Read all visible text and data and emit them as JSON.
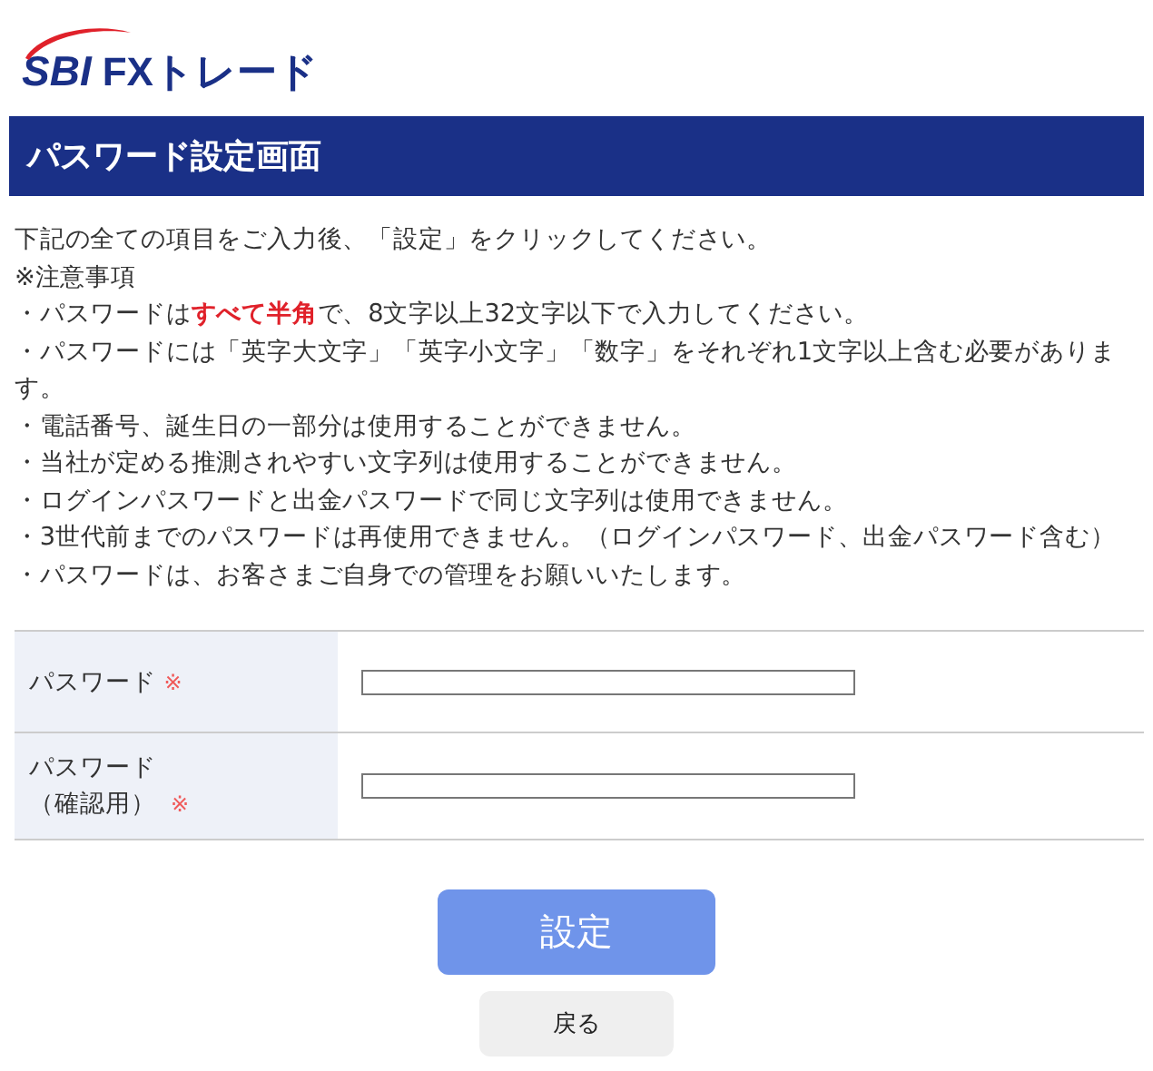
{
  "logo": {
    "brand": "SBI",
    "product": "FXトレード"
  },
  "title": "パスワード設定画面",
  "intro": "下記の全ての項目をご入力後、「設定」をクリックしてください。",
  "notes_heading": "※注意事項",
  "notes": [
    "・パスワードは**すべて半角**で、8文字以上32文字以下で入力してください。",
    "・パスワードには「英字大文字」「英字小文字」「数字」をそれぞれ1文字以上含む必要があります。",
    "・電話番号、誕生日の一部分は使用することができません。",
    "・当社が定める推測されやすい文字列は使用することができません。",
    "・ログインパスワードと出金パスワードで同じ文字列は使用できません。",
    "・3世代前までのパスワードは再使用できません。（ログインパスワード、出金パスワード含む）",
    "・パスワードは、お客さまご自身での管理をお願いいたします。"
  ],
  "fields": [
    {
      "label": "パスワード",
      "required_mark": "※"
    },
    {
      "label": "パスワード",
      "sublabel": "（確認用）",
      "required_mark": "※"
    }
  ],
  "buttons": {
    "submit": "設定",
    "back": "戻る"
  }
}
